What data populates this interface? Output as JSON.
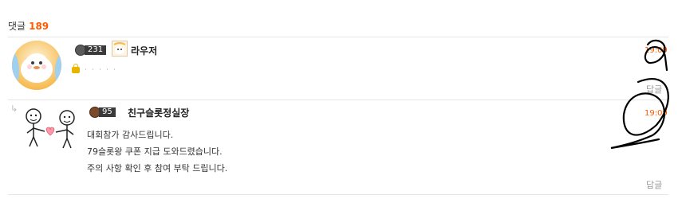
{
  "header": {
    "label": "댓글",
    "count": "189"
  },
  "comments": [
    {
      "level": "231",
      "nickname": "라우저",
      "masked_text": "· · ·  · ·",
      "time": "19:09",
      "reply_label": "답글"
    },
    {
      "level": "95",
      "nickname": "친구슬롯정실장",
      "lines": [
        "대회참가 감사드립니다.",
        "79슬롯왕 쿠폰 지급 도와드렸습니다.",
        "주의 사항 확인 후 참여 부탁 드립니다."
      ],
      "time": "19:09",
      "reply_label": "답글"
    }
  ],
  "colors": {
    "accent": "#ff5a00",
    "annotation": "#000000"
  },
  "icons": {
    "lock": "lock-icon",
    "reply_arrow": "reply-arrow-icon",
    "level_badge": "level-badge-icon"
  }
}
